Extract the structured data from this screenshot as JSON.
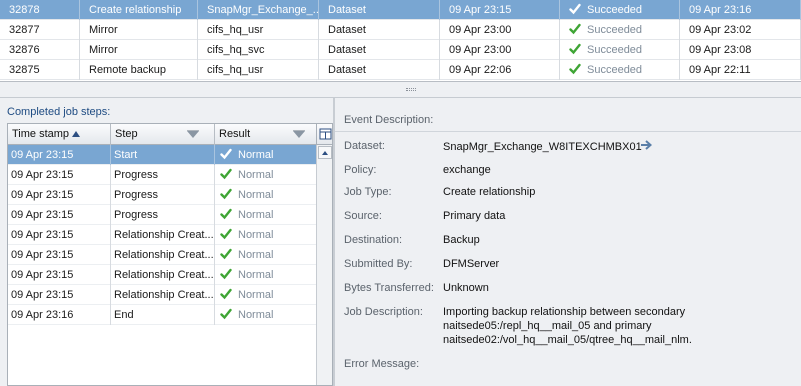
{
  "jobs": [
    {
      "id": "32878",
      "type": "Create relationship",
      "source": "SnapMgr_Exchange_...",
      "destination": "Dataset",
      "started": "09 Apr 23:15",
      "status": "Succeeded",
      "ended": "09 Apr 23:16",
      "selected": true
    },
    {
      "id": "32877",
      "type": "Mirror",
      "source": "cifs_hq_usr",
      "destination": "Dataset",
      "started": "09 Apr 23:00",
      "status": "Succeeded",
      "ended": "09 Apr 23:02",
      "selected": false
    },
    {
      "id": "32876",
      "type": "Mirror",
      "source": "cifs_hq_svc",
      "destination": "Dataset",
      "started": "09 Apr 23:00",
      "status": "Succeeded",
      "ended": "09 Apr 23:08",
      "selected": false
    },
    {
      "id": "32875",
      "type": "Remote backup",
      "source": "cifs_hq_usr",
      "destination": "Dataset",
      "started": "09 Apr 22:06",
      "status": "Succeeded",
      "ended": "09 Apr 22:11",
      "selected": false
    }
  ],
  "steps_panel": {
    "heading": "Completed job steps:",
    "columns": {
      "timestamp": "Time stamp",
      "step": "Step",
      "result": "Result"
    },
    "rows": [
      {
        "time": "09 Apr 23:15",
        "step": "Start",
        "result": "Normal",
        "selected": true
      },
      {
        "time": "09 Apr 23:15",
        "step": "Progress",
        "result": "Normal",
        "selected": false
      },
      {
        "time": "09 Apr 23:15",
        "step": "Progress",
        "result": "Normal",
        "selected": false
      },
      {
        "time": "09 Apr 23:15",
        "step": "Progress",
        "result": "Normal",
        "selected": false
      },
      {
        "time": "09 Apr 23:15",
        "step": "Relationship Creat...",
        "result": "Normal",
        "selected": false
      },
      {
        "time": "09 Apr 23:15",
        "step": "Relationship Creat...",
        "result": "Normal",
        "selected": false
      },
      {
        "time": "09 Apr 23:15",
        "step": "Relationship Creat...",
        "result": "Normal",
        "selected": false
      },
      {
        "time": "09 Apr 23:15",
        "step": "Relationship Creat...",
        "result": "Normal",
        "selected": false
      },
      {
        "time": "09 Apr 23:16",
        "step": "End",
        "result": "Normal",
        "selected": false
      }
    ]
  },
  "details": {
    "event_description_label": "Event Description:",
    "dataset_label": "Dataset:",
    "dataset_value": "SnapMgr_Exchange_W8ITEXCHMBX01",
    "policy_label": "Policy:",
    "policy_value": "exchange",
    "job_type_label": "Job Type:",
    "job_type_value": "Create relationship",
    "source_label": "Source:",
    "source_value": "Primary data",
    "destination_label": "Destination:",
    "destination_value": "Backup",
    "submitted_by_label": "Submitted By:",
    "submitted_by_value": "DFMServer",
    "bytes_transferred_label": "Bytes Transferred:",
    "bytes_transferred_value": "Unknown",
    "job_description_label": "Job Description:",
    "job_description_lines": [
      "Importing backup relationship between secondary",
      "naitsede05:/repl_hq__mail_05 and primary",
      "naitsede02:/vol_hq__mail_05/qtree_hq__mail_nlm."
    ],
    "error_message_label": "Error Message:"
  },
  "icons": {
    "success": "checkmark-icon",
    "sort": "sort-ascending-icon",
    "filter": "filter-icon",
    "navigate": "arrow-right-icon",
    "column_chooser": "column-chooser-icon"
  },
  "colors": {
    "selection": "#79a6d2",
    "success_check": "#3fa535",
    "muted_text": "#7f8c99",
    "heading_blue": "#1e4b82"
  }
}
